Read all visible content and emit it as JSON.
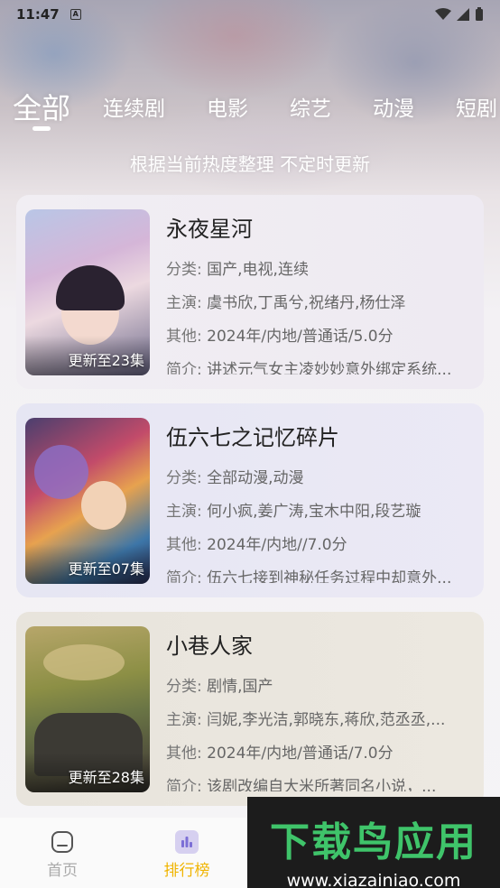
{
  "status": {
    "time": "11:47",
    "notif_icon": "A"
  },
  "tabs": [
    {
      "label": "全部",
      "active": true
    },
    {
      "label": "连续剧"
    },
    {
      "label": "电影"
    },
    {
      "label": "综艺"
    },
    {
      "label": "动漫"
    },
    {
      "label": "短剧"
    }
  ],
  "subtitle": "根据当前热度整理 不定时更新",
  "cards": [
    {
      "title": "永夜星河",
      "badge": "更新至23集",
      "category_label": "分类:",
      "category": "国产,电视,连续",
      "cast_label": "主演:",
      "cast": "虞书欣,丁禹兮,祝绪丹,杨仕泽",
      "other_label": "其他:",
      "other": "2024年/内地/普通话/5.0分",
      "desc_label": "简介:",
      "desc": "讲述元气女主凌妙妙意外绑定系统..."
    },
    {
      "title": "伍六七之记忆碎片",
      "badge": "更新至07集",
      "category_label": "分类:",
      "category": "全部动漫,动漫",
      "cast_label": "主演:",
      "cast": "何小疯,姜广涛,宝木中阳,段艺璇",
      "other_label": "其他:",
      "other": "2024年/内地//7.0分",
      "desc_label": "简介:",
      "desc": "伍六七接到神秘任务过程中却意外..."
    },
    {
      "title": "小巷人家",
      "badge": "更新至28集",
      "category_label": "分类:",
      "category": "剧情,国产",
      "cast_label": "主演:",
      "cast": "闫妮,李光洁,郭晓东,蒋欣,范丞丞,...",
      "other_label": "其他:",
      "other": "2024年/内地/普通话/7.0分",
      "desc_label": "简介:",
      "desc": "该剧改编自大米所著同名小说，..."
    }
  ],
  "nav": [
    {
      "label": "首页",
      "icon": "home-icon"
    },
    {
      "label": "排行榜",
      "icon": "ranking-icon",
      "active": true
    }
  ],
  "watermark": {
    "big": "下载鸟应用",
    "small": "www.xiazainiao.com"
  },
  "colors": {
    "accent": "#f0b400",
    "watermark_green": "#3fc46a"
  }
}
